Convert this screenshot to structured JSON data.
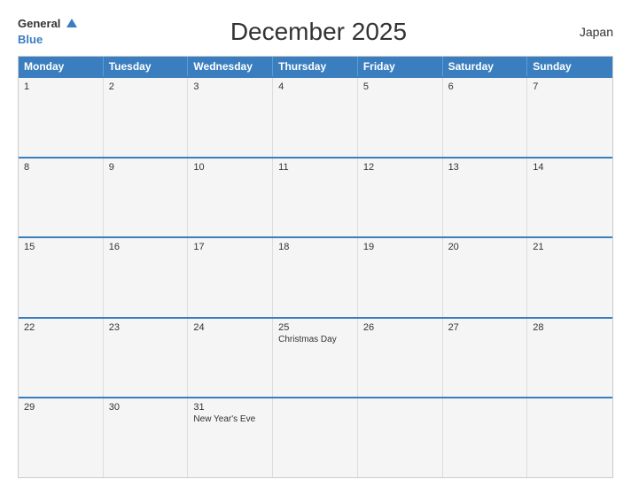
{
  "header": {
    "logo_general": "General",
    "logo_blue": "Blue",
    "title": "December 2025",
    "country": "Japan"
  },
  "weekdays": [
    "Monday",
    "Tuesday",
    "Wednesday",
    "Thursday",
    "Friday",
    "Saturday",
    "Sunday"
  ],
  "weeks": [
    [
      {
        "day": "1",
        "event": ""
      },
      {
        "day": "2",
        "event": ""
      },
      {
        "day": "3",
        "event": ""
      },
      {
        "day": "4",
        "event": ""
      },
      {
        "day": "5",
        "event": ""
      },
      {
        "day": "6",
        "event": ""
      },
      {
        "day": "7",
        "event": ""
      }
    ],
    [
      {
        "day": "8",
        "event": ""
      },
      {
        "day": "9",
        "event": ""
      },
      {
        "day": "10",
        "event": ""
      },
      {
        "day": "11",
        "event": ""
      },
      {
        "day": "12",
        "event": ""
      },
      {
        "day": "13",
        "event": ""
      },
      {
        "day": "14",
        "event": ""
      }
    ],
    [
      {
        "day": "15",
        "event": ""
      },
      {
        "day": "16",
        "event": ""
      },
      {
        "day": "17",
        "event": ""
      },
      {
        "day": "18",
        "event": ""
      },
      {
        "day": "19",
        "event": ""
      },
      {
        "day": "20",
        "event": ""
      },
      {
        "day": "21",
        "event": ""
      }
    ],
    [
      {
        "day": "22",
        "event": ""
      },
      {
        "day": "23",
        "event": ""
      },
      {
        "day": "24",
        "event": ""
      },
      {
        "day": "25",
        "event": "Christmas Day"
      },
      {
        "day": "26",
        "event": ""
      },
      {
        "day": "27",
        "event": ""
      },
      {
        "day": "28",
        "event": ""
      }
    ],
    [
      {
        "day": "29",
        "event": ""
      },
      {
        "day": "30",
        "event": ""
      },
      {
        "day": "31",
        "event": "New Year's Eve"
      },
      {
        "day": "",
        "event": ""
      },
      {
        "day": "",
        "event": ""
      },
      {
        "day": "",
        "event": ""
      },
      {
        "day": "",
        "event": ""
      }
    ]
  ]
}
